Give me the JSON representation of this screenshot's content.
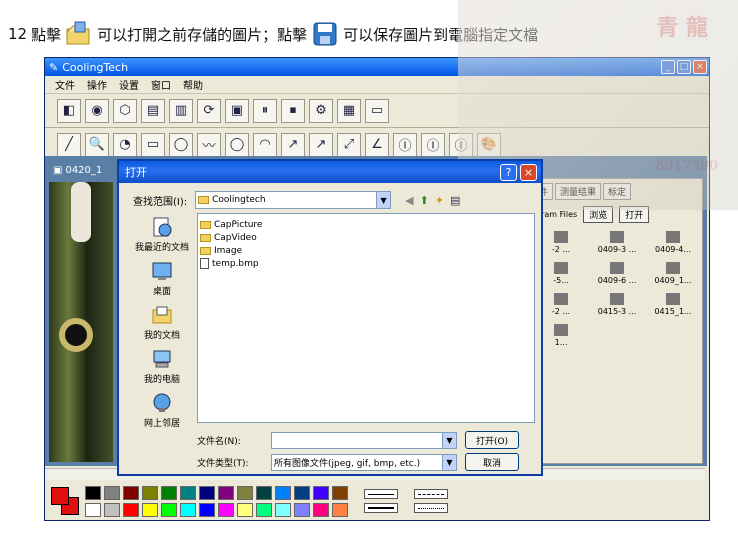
{
  "caption": {
    "num": "12",
    "part1": "點擊",
    "part2": "可以打開之前存儲的圖片；點擊",
    "part3": "可以保存圖片到電腦指定文檔",
    "open_icon": "open-folder-icon",
    "save_icon": "floppy-save-icon"
  },
  "watermark": {
    "line1": "青 龍",
    "line2": "8917390"
  },
  "app": {
    "title": "CoolingTech",
    "menu": [
      "文件",
      "操作",
      "设置",
      "窗口",
      "帮助"
    ],
    "toolbar1": [
      "◧",
      "◉",
      "⬡",
      "▤",
      "▥",
      "⟳",
      "▣",
      "⏸",
      "⏹",
      "⚙",
      "▦",
      "▭"
    ],
    "toolbar2": [
      "╱",
      "🔍",
      "◔",
      "▭",
      "◯",
      "〰",
      "◯",
      "◠",
      "↗",
      "↗",
      "⤢",
      "∠",
      "Ⓘ",
      "Ⓘ",
      "Ⓘ",
      "🎨"
    ],
    "doc_title": "0420_1",
    "right_panel": {
      "tabs": [
        "件",
        "测量结果",
        "标定"
      ],
      "files_label": "gram Files",
      "browse_btn": "浏览",
      "open_btn": "打开",
      "thumbs": [
        "-2 ...",
        "0409-3 ...",
        "0409-4...",
        "-5...",
        "0409-6 ...",
        "0409_1...",
        "-2 ...",
        "0415-3 ...",
        "0415_1...",
        "1..."
      ]
    },
    "palette_colors": [
      "#000000",
      "#808080",
      "#800000",
      "#808000",
      "#008000",
      "#008080",
      "#000080",
      "#800080",
      "#808040",
      "#004040",
      "#0080ff",
      "#004080",
      "#4000ff",
      "#804000",
      "#ffffff",
      "#c0c0c0",
      "#ff0000",
      "#ffff00",
      "#00ff00",
      "#00ffff",
      "#0000ff",
      "#ff00ff",
      "#ffff80",
      "#00ff80",
      "#80ffff",
      "#8080ff",
      "#ff0080",
      "#ff8040"
    ]
  },
  "dialog": {
    "title": "打开",
    "look_in_label": "查找范围(I):",
    "look_in_value": "Coolingtech",
    "places": [
      "我最近的文档",
      "桌面",
      "我的文档",
      "我的电脑",
      "网上邻居"
    ],
    "files": [
      {
        "name": "CapPicture",
        "kind": "folder"
      },
      {
        "name": "CapVideo",
        "kind": "folder"
      },
      {
        "name": "Image",
        "kind": "folder"
      },
      {
        "name": "temp.bmp",
        "kind": "bmp"
      }
    ],
    "filename_label": "文件名(N):",
    "filename_value": "",
    "filetype_label": "文件类型(T):",
    "filetype_value": "所有图像文件(jpeg, gif, bmp, etc.)",
    "open_btn": "打开(O)",
    "cancel_btn": "取消"
  }
}
